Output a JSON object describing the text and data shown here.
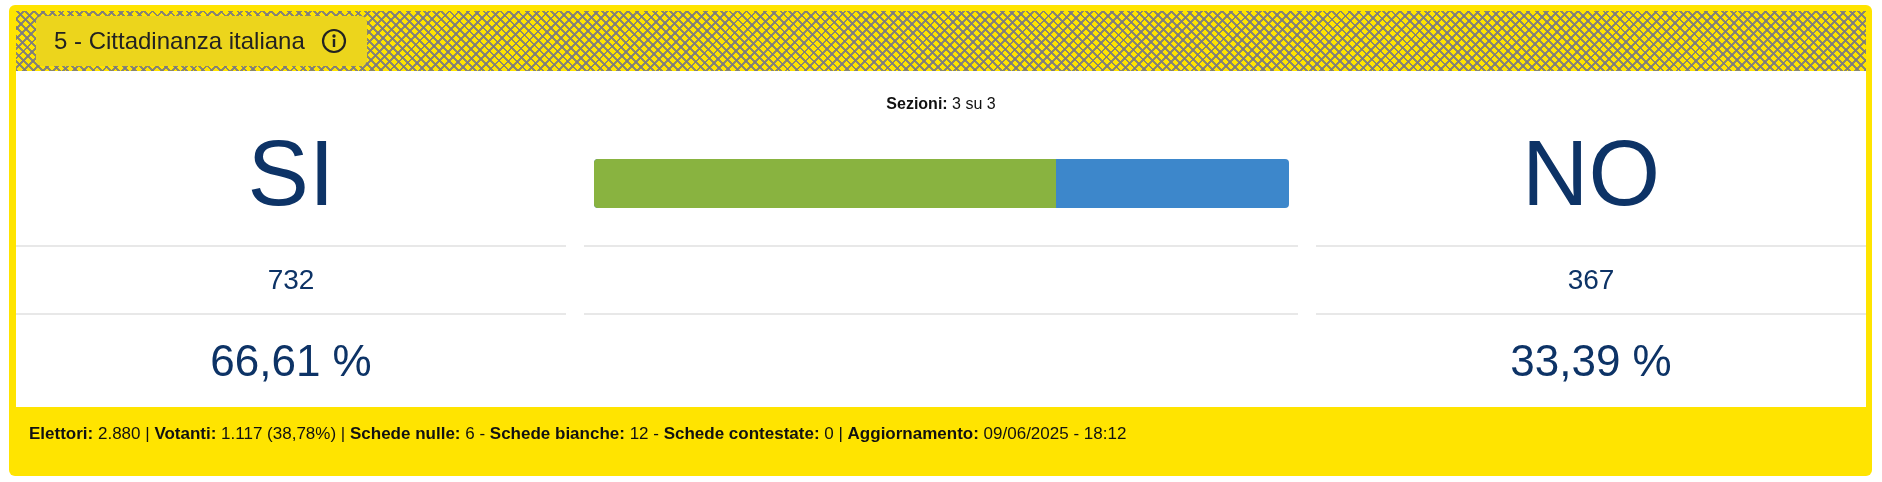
{
  "card": {
    "title": "5 - Cittadinanza italiana",
    "sections": "**Sezioni:** 3 su 3",
    "options": [
      {
        "label": "SI",
        "votes": "732",
        "percent": "66,61 %"
      },
      {
        "label": "NO",
        "votes": "367",
        "percent": "33,39 %"
      }
    ],
    "bar": {
      "level": 0.6661
    },
    "footer": "**Elettori:** 2.880 | **Votanti:** 1.117 (38,78%) | **Schede nulle:** 6 - **Schede bianche:** 12 - **Schede contestate:** 0 | **Aggiornamento:** 09/06/2025 - 18:12"
  }
}
